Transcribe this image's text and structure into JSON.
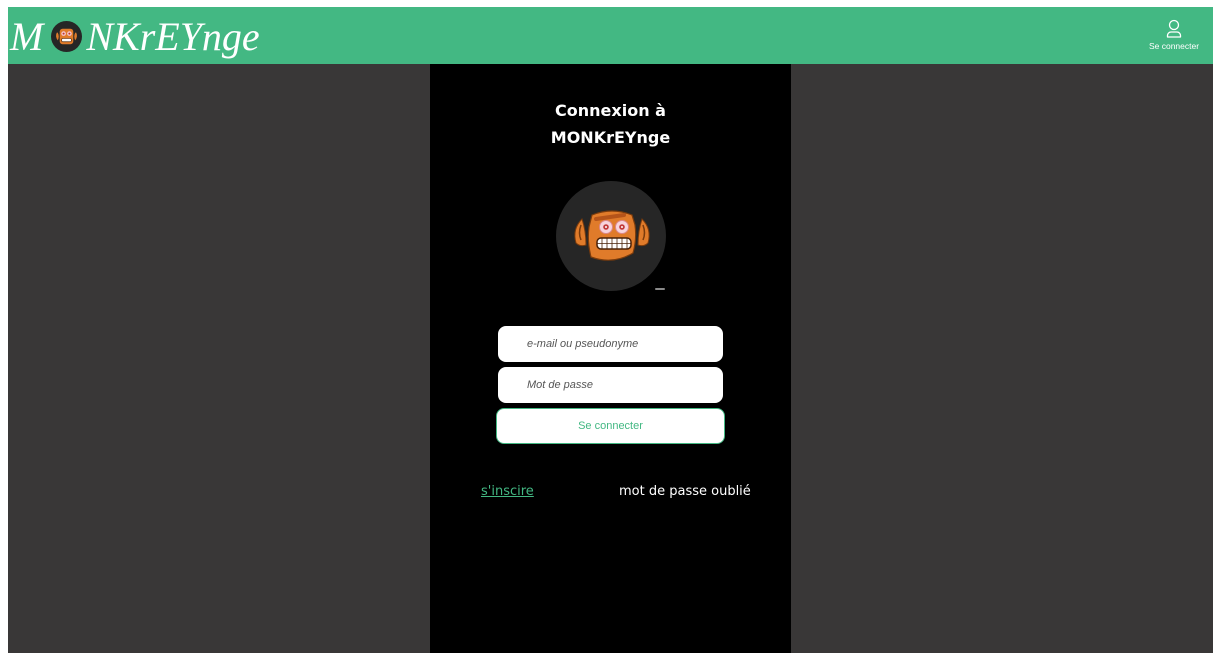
{
  "header": {
    "logo_text_start": "M",
    "logo_text_end": "NKrEYnge",
    "logo_icon": "monkey-face-icon",
    "login_icon": "user-icon",
    "login_label": "Se connecter",
    "background": "#43b883"
  },
  "login": {
    "title_line1": "Connexion à",
    "title_line2": "MONKrEYnge",
    "avatar_icon": "monkey-face-icon",
    "email_placeholder": "e-mail ou pseudonyme",
    "password_placeholder": "Mot de passe",
    "submit_label": "Se connecter",
    "signup_link": "s'inscire",
    "forgot_link": "mot de passe oublié"
  },
  "colors": {
    "accent": "#43b883",
    "page_background": "#393737",
    "panel_background": "#000000"
  }
}
